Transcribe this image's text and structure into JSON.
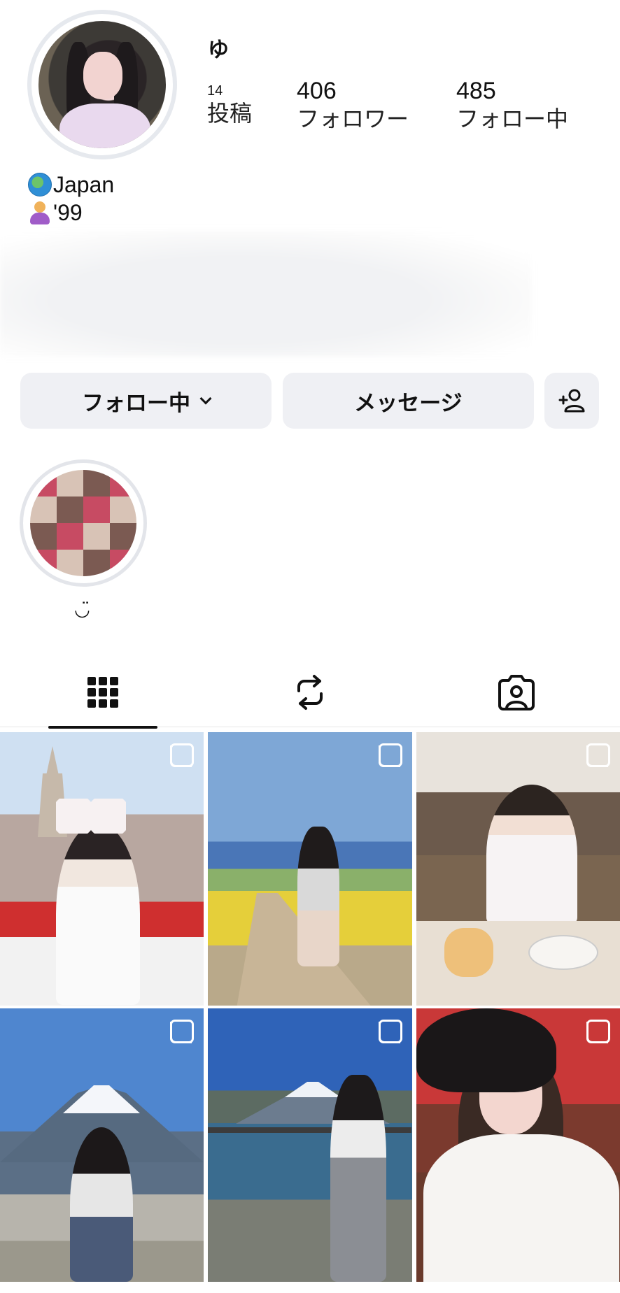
{
  "profile": {
    "username": "ゆ",
    "avatar_icon": "profile-photo",
    "stats": {
      "posts": {
        "value": "14",
        "label": "投稿"
      },
      "followers": {
        "value": "406",
        "label": "フォロワー"
      },
      "following": {
        "value": "485",
        "label": "フォロー中"
      }
    },
    "bio": {
      "line1_icon": "globe-icon",
      "line1_text": "Japan",
      "line2_icon": "person-icon",
      "line2_text": "'99"
    }
  },
  "actions": {
    "following_label": "フォロー中",
    "message_label": "メッセージ",
    "add_user_icon": "add-user-icon"
  },
  "highlights": [
    {
      "label": "◡̈"
    }
  ],
  "tabs": [
    {
      "icon": "grid-icon",
      "selected": true
    },
    {
      "icon": "reposts-icon",
      "selected": false
    },
    {
      "icon": "tagged-icon",
      "selected": false
    }
  ],
  "posts": [
    {
      "type": "carousel"
    },
    {
      "type": "carousel"
    },
    {
      "type": "carousel"
    },
    {
      "type": "carousel"
    },
    {
      "type": "carousel"
    },
    {
      "type": "carousel"
    }
  ],
  "colors": {
    "button_bg": "#eff0f4",
    "ring": "#e6e9ee",
    "text": "#111111"
  }
}
